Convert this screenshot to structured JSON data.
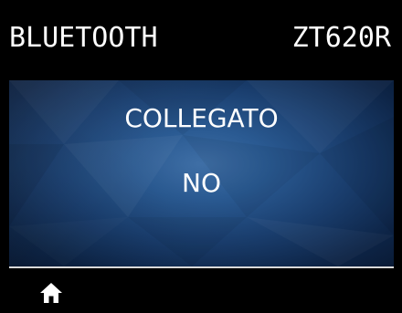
{
  "header": {
    "title": "BLUETOOTH",
    "model": "ZT620R"
  },
  "main": {
    "setting_label": "COLLEGATO",
    "setting_value": "NO"
  },
  "footer": {
    "home_icon": "home-icon"
  },
  "colors": {
    "background": "#000000",
    "text": "#ffffff",
    "panel_center": "#3f6fa6",
    "panel_edge": "#0a1c38"
  }
}
